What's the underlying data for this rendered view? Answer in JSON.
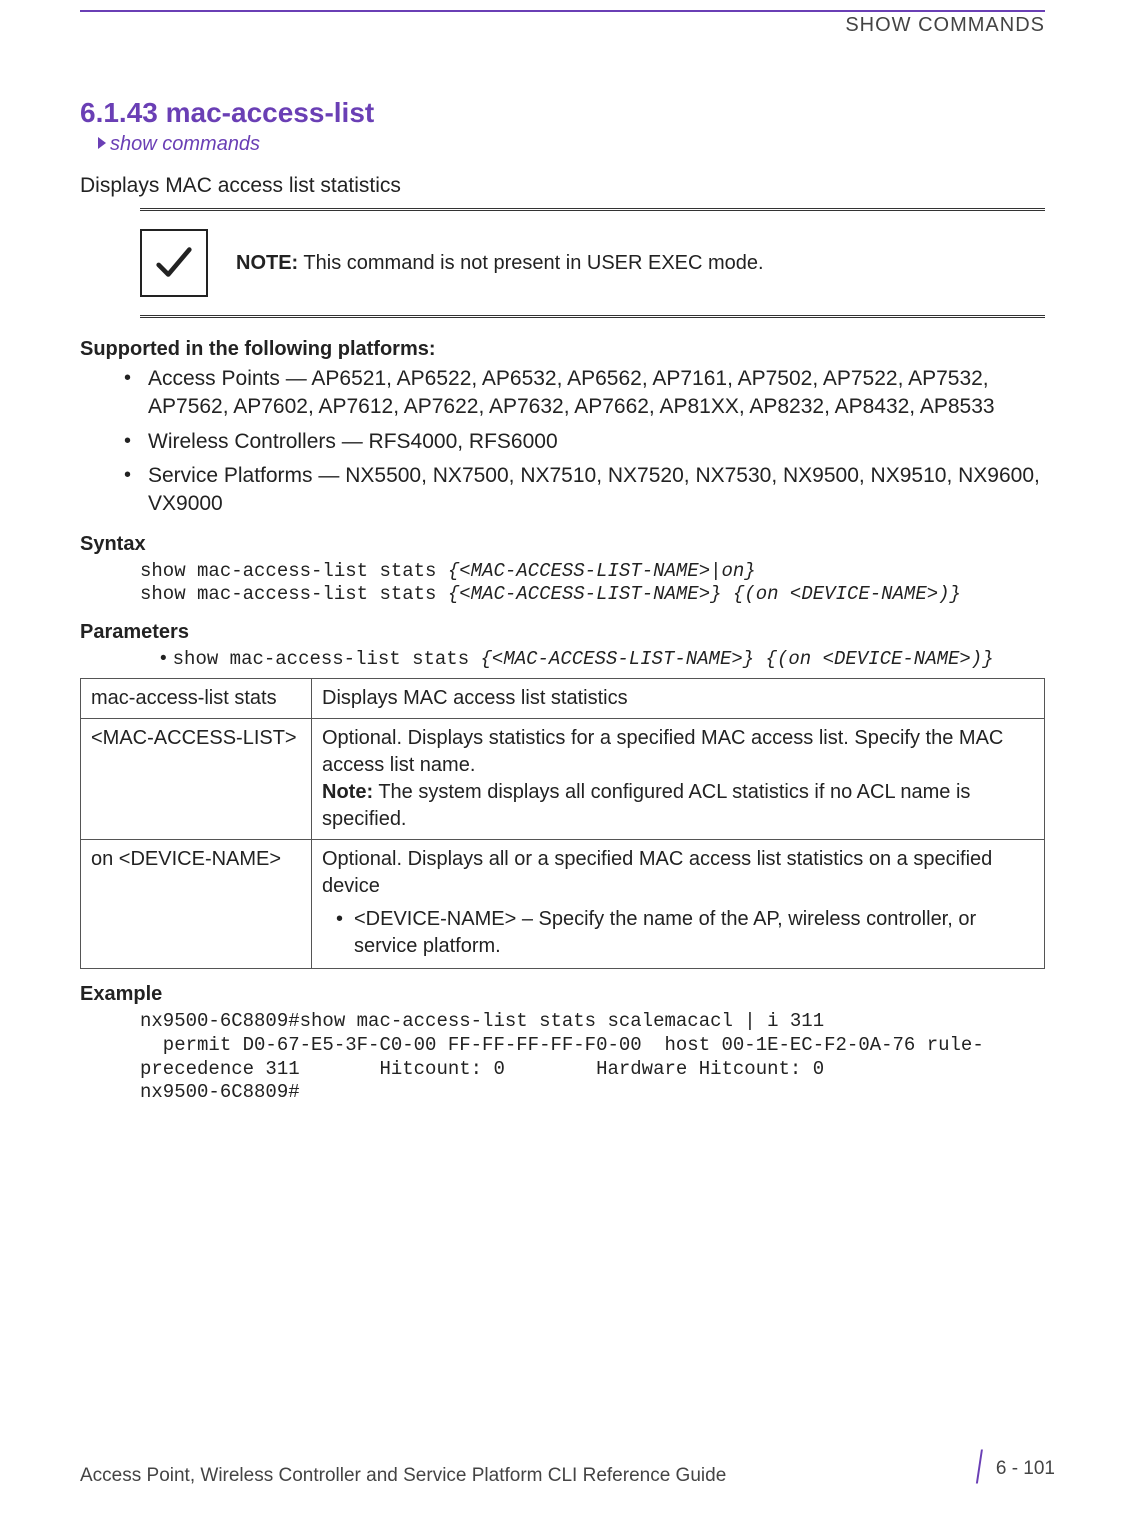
{
  "header": {
    "running_head": "SHOW COMMANDS"
  },
  "section": {
    "number": "6.1.43",
    "title": "mac-access-list",
    "breadcrumb": "show commands",
    "intro": "Displays MAC access list statistics"
  },
  "note": {
    "label": "NOTE:",
    "text": "This command is not present in USER EXEC mode."
  },
  "supported": {
    "heading": "Supported in the following platforms:",
    "items": [
      "Access Points — AP6521, AP6522, AP6532, AP6562, AP7161, AP7502, AP7522, AP7532, AP7562, AP7602, AP7612, AP7622, AP7632, AP7662, AP81XX, AP8232, AP8432, AP8533",
      "Wireless Controllers — RFS4000, RFS6000",
      "Service Platforms — NX5500, NX7500, NX7510, NX7520, NX7530, NX9500, NX9510, NX9600, VX9000"
    ]
  },
  "syntax": {
    "heading": "Syntax",
    "line1_cmd": "show mac-access-list stats ",
    "line1_arg": "{<MAC-ACCESS-LIST-NAME>|on}",
    "line2_cmd": "show mac-access-list stats ",
    "line2_arg": "{<MAC-ACCESS-LIST-NAME>} {(on <DEVICE-NAME>)}"
  },
  "parameters": {
    "heading": "Parameters",
    "cmd_prefix": "show mac-access-list stats ",
    "cmd_args": "{<MAC-ACCESS-LIST-NAME>} {(on <DEVICE-NAME>)}",
    "rows": [
      {
        "name": "mac-access-list stats",
        "desc": "Displays MAC access list statistics"
      },
      {
        "name": "<MAC-ACCESS-LIST>",
        "desc": "Optional. Displays statistics for a specified MAC access list. Specify the MAC access list name.",
        "note_label": "Note:",
        "note_text": "The system displays all configured ACL statistics if no ACL name is specified."
      },
      {
        "name": "on <DEVICE-NAME>",
        "desc": "Optional. Displays all or a specified MAC access list statistics on a specified device",
        "sub": "<DEVICE-NAME> – Specify the name of the AP, wireless controller, or service platform."
      }
    ]
  },
  "example": {
    "heading": "Example",
    "text": "nx9500-6C8809#show mac-access-list stats scalemacacl | i 311\n  permit D0-67-E5-3F-C0-00 FF-FF-FF-FF-F0-00  host 00-1E-EC-F2-0A-76 rule-\nprecedence 311       Hitcount: 0        Hardware Hitcount: 0\nnx9500-6C8809#"
  },
  "footer": {
    "guide": "Access Point, Wireless Controller and Service Platform CLI Reference Guide",
    "page": "6 - 101"
  }
}
